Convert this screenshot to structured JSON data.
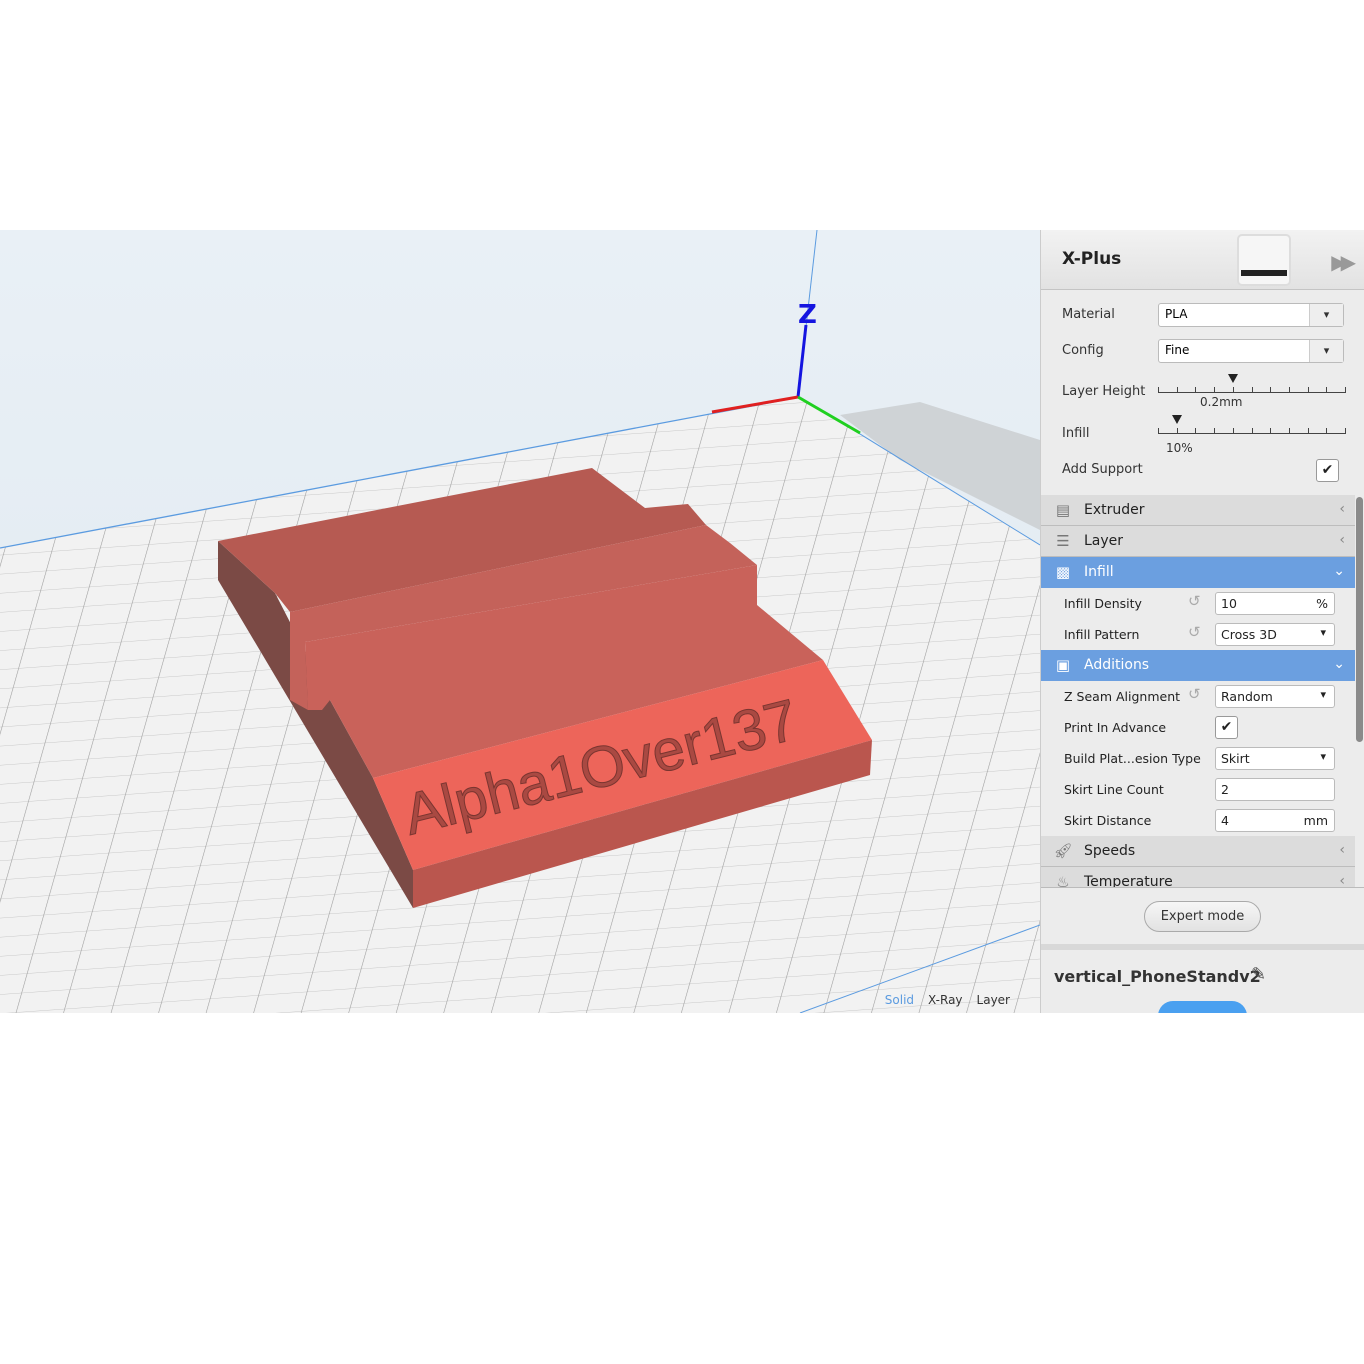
{
  "viewport": {
    "model_text": "Alpha1Over137",
    "axis_label": "Z",
    "view_modes": [
      "Solid",
      "X-Ray",
      "Layer"
    ],
    "active_mode": "Solid",
    "model_color": "#e8665c"
  },
  "panel": {
    "printer_name": "X-Plus",
    "material": {
      "label": "Material",
      "value": "PLA"
    },
    "config": {
      "label": "Config",
      "value": "Fine"
    },
    "layer_height": {
      "label": "Layer Height",
      "value": "0.2mm",
      "fraction": 0.4
    },
    "infill": {
      "label": "Infill",
      "value": "10%",
      "fraction": 0.1
    },
    "add_support": {
      "label": "Add Support",
      "checked": true
    },
    "sections": {
      "extruder": "Extruder",
      "layer": "Layer",
      "infill": "Infill",
      "additions": "Additions",
      "speeds": "Speeds",
      "temperature": "Temperature"
    },
    "settings": {
      "infill_density": {
        "label": "Infill Density",
        "value": "10",
        "unit": "%"
      },
      "infill_pattern": {
        "label": "Infill Pattern",
        "value": "Cross 3D"
      },
      "z_seam": {
        "label": "Z Seam Alignment",
        "value": "Random"
      },
      "print_in_advance": {
        "label": "Print In Advance",
        "checked": true
      },
      "adhesion": {
        "label": "Build Plat...esion Type",
        "value": "Skirt"
      },
      "skirt_line_count": {
        "label": "Skirt Line Count",
        "value": "2"
      },
      "skirt_distance": {
        "label": "Skirt Distance",
        "value": "4",
        "unit": "mm"
      }
    },
    "expert_mode": "Expert mode",
    "file_name": "vertical_PhoneStandv2",
    "accent": "#6b9fe0"
  }
}
